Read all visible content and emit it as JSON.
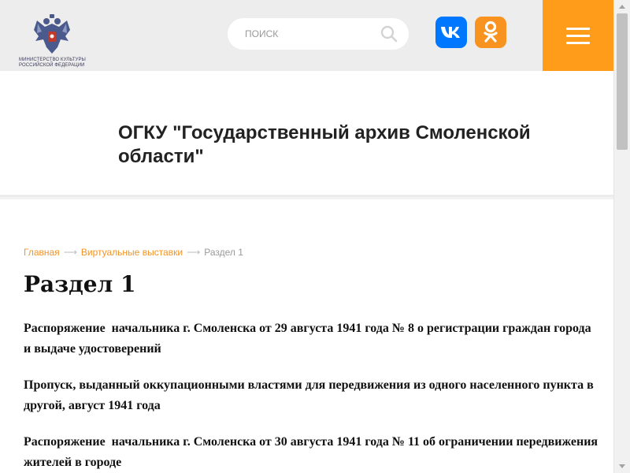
{
  "header": {
    "logo_text_line1": "Министерство культуры",
    "logo_text_line2": "Российской Федерации",
    "search_placeholder": "ПОИСК",
    "vk_label": "VK",
    "colors": {
      "accent": "#ff9c1a",
      "vk": "#0077ff",
      "ok": "#f7931e"
    }
  },
  "org_title": "ОГКУ \"Государственный архив Смоленской области\"",
  "breadcrumb": {
    "home": "Главная",
    "section": "Виртуальные выставки",
    "current": "Раздел 1",
    "separator": "⟶"
  },
  "page_title": "Раздел 1",
  "documents": [
    "Распоряжение  начальника г. Смоленска от 29 августа 1941 года № 8 о регистрации граждан города и выдаче удостоверений",
    "Пропуск, выданный оккупационными властями для передвижения из одного населенного пункта в другой, август 1941 года",
    "Распоряжение  начальника г. Смоленска от 30 августа 1941 года № 11 об ограничении передвижения жителей в городе"
  ]
}
